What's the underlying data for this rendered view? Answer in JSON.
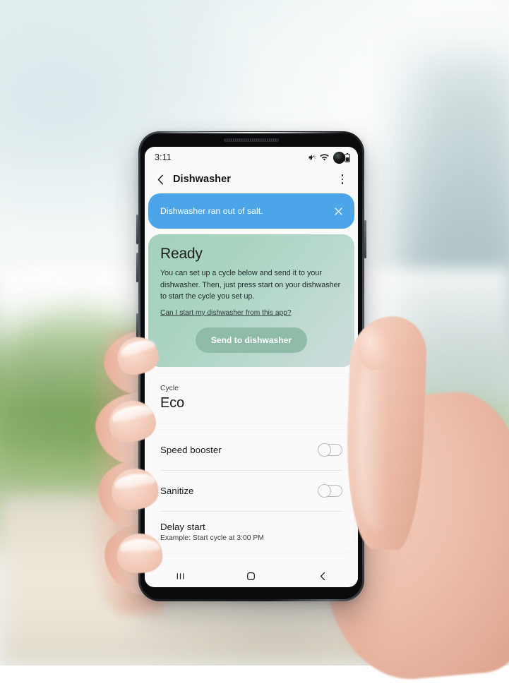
{
  "statusbar": {
    "time": "3:11",
    "icons": [
      "mute-icon",
      "wifi-icon",
      "do-not-disturb-icon",
      "battery-icon"
    ],
    "camera": "punch-hole-camera"
  },
  "appbar": {
    "back_icon": "back-chevron-icon",
    "title": "Dishwasher",
    "menu_icon": "overflow-menu-icon"
  },
  "banner": {
    "message": "Dishwasher ran out of salt.",
    "close_icon": "close-icon",
    "color": "#4ca5e8"
  },
  "ready_card": {
    "title": "Ready",
    "body": "You can set up a cycle below and send it to your dishwasher. Then, just press start on your dishwasher to start the cycle you set up.",
    "link": "Can I start my dishwasher from this app?",
    "button_label": "Send to dishwasher",
    "button_color": "#8fbca8",
    "gradient_from": "#a3d2bd",
    "gradient_to": "#cbdcdc"
  },
  "cycle_card": {
    "label": "Cycle",
    "value": "Eco"
  },
  "settings": {
    "rows": [
      {
        "label": "Speed booster",
        "control": "toggle",
        "state": "off"
      },
      {
        "label": "Sanitize",
        "control": "toggle",
        "state": "off"
      }
    ],
    "delay": {
      "title": "Delay start",
      "subtitle": "Example: Start cycle at 3:00 PM"
    }
  },
  "navbar": {
    "recents": "recents-icon",
    "home": "home-icon",
    "back": "back-icon"
  }
}
